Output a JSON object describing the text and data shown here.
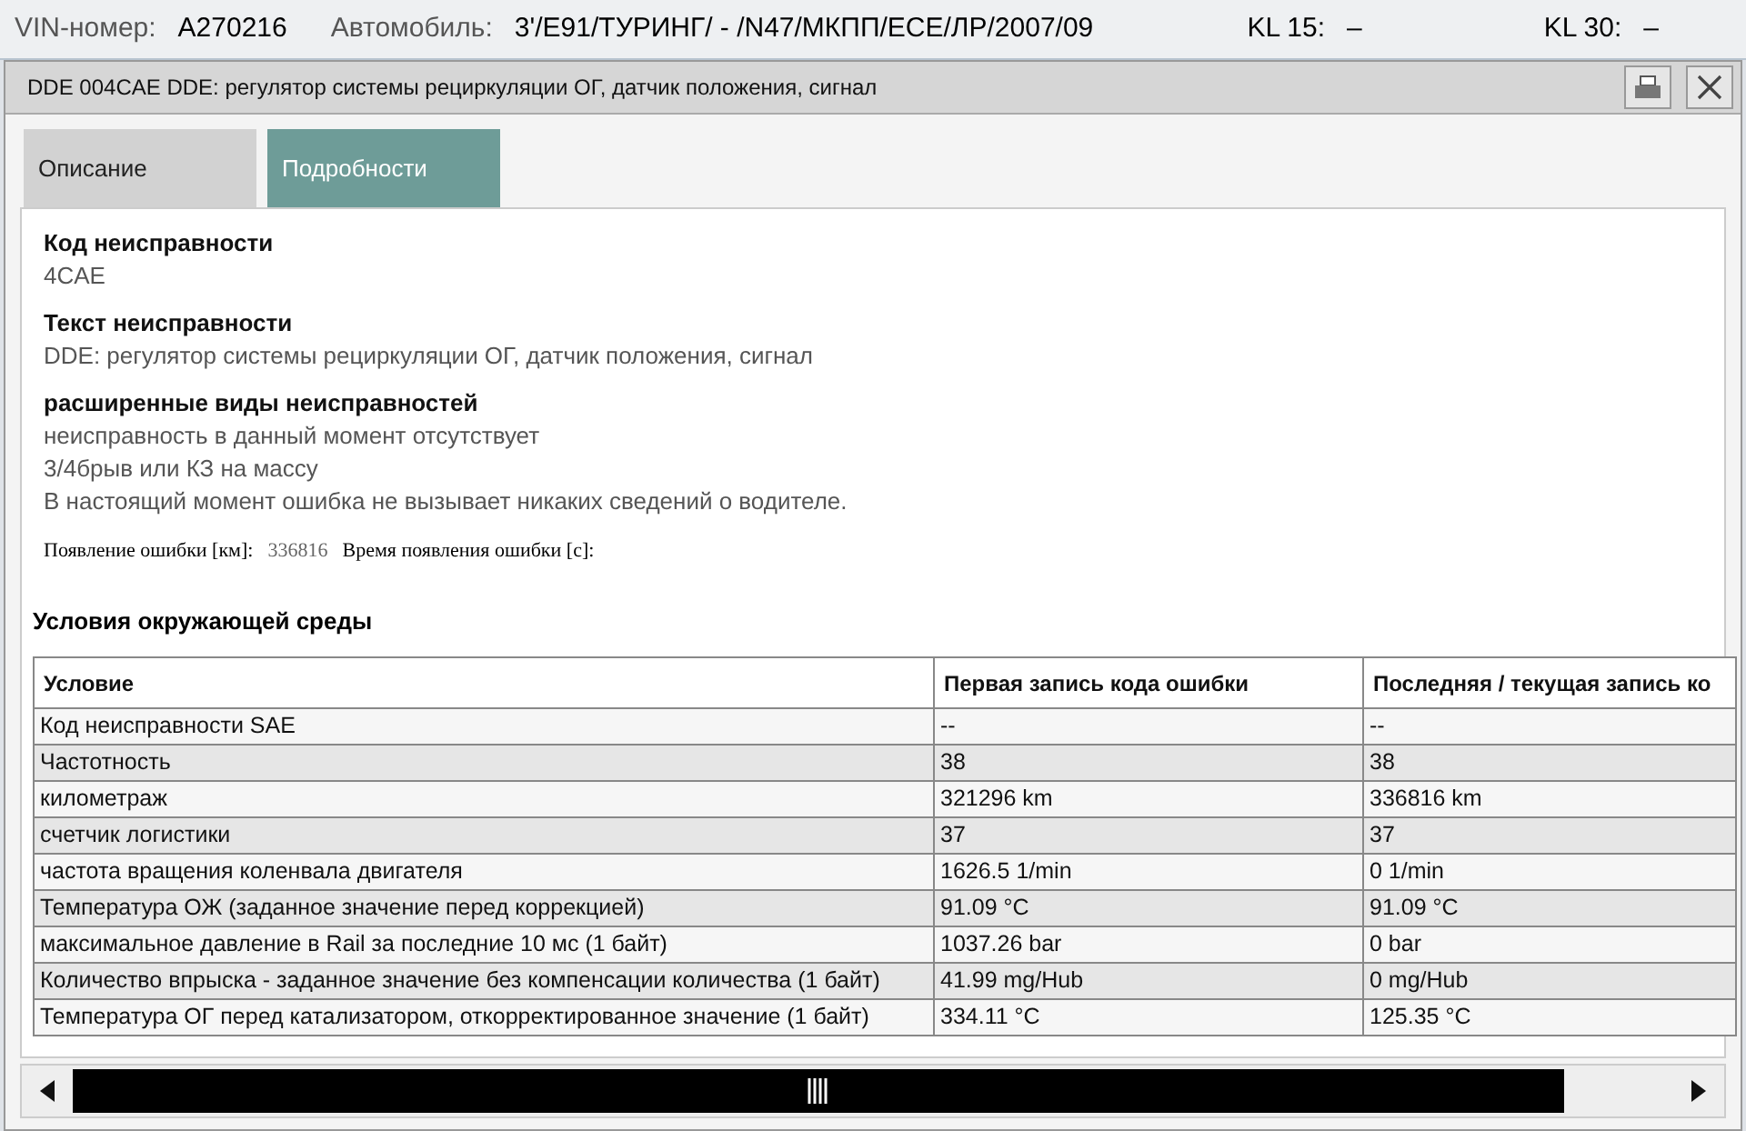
{
  "header": {
    "vin_label": "VIN-номер:",
    "vin": "A270216",
    "car_label": "Автомобиль:",
    "car": "3'/E91/ТУРИНГ/ - /N47/МКПП/ЕСЕ/ЛР/2007/09",
    "kl15_label": "KL 15:",
    "kl15": "–",
    "kl30_label": "KL 30:",
    "kl30": "–"
  },
  "window": {
    "title": "DDE 004CAE DDE: регулятор системы рециркуляции ОГ, датчик положения, сигнал"
  },
  "tabs": [
    {
      "label": "Описание",
      "selected": false
    },
    {
      "label": "Подробности",
      "selected": true
    }
  ],
  "sections": [
    {
      "heading": "Код неисправности",
      "lines": [
        "4CAE"
      ]
    },
    {
      "heading": "Текст неисправности",
      "lines": [
        "DDE: регулятор системы рециркуляции ОГ, датчик положения, сигнал"
      ]
    },
    {
      "heading": "расширенные виды неисправностей",
      "lines": [
        "неисправность в данный момент отсутствует",
        "3/4брыв или КЗ на массу",
        "В настоящий момент ошибка не вызывает никаких сведений о водителе."
      ]
    }
  ],
  "occurrence": {
    "km_label": "Появление ошибки [км]:",
    "km": "336816",
    "time_label": "Время появления ошибки [с]:"
  },
  "table": {
    "title": "Условия окружающей среды",
    "columns": [
      "Условие",
      "Первая запись кода ошибки",
      "Последняя / текущая запись ко"
    ],
    "rows": [
      [
        "Код неисправности SAE",
        "--",
        "--"
      ],
      [
        "Частотность",
        "38",
        "38"
      ],
      [
        "километраж",
        "321296 km",
        "336816 km"
      ],
      [
        "счетчик логистики",
        "37",
        "37"
      ],
      [
        "частота вращения коленвала двигателя",
        "1626.5 1/min",
        "0 1/min"
      ],
      [
        "Температура ОЖ (заданное значение перед коррекцией)",
        "91.09 °C",
        "91.09 °C"
      ],
      [
        "максимальное давление в Rail за последние 10 мс (1 байт)",
        "1037.26 bar",
        "0 bar"
      ],
      [
        "Количество впрыска - заданное значение без компенсации количества (1 байт)",
        "41.99 mg/Hub",
        "0 mg/Hub"
      ],
      [
        "Температура ОГ перед катализатором, откорректированное значение (1 байт)",
        "334.11 °C",
        "125.35 °C"
      ]
    ]
  }
}
